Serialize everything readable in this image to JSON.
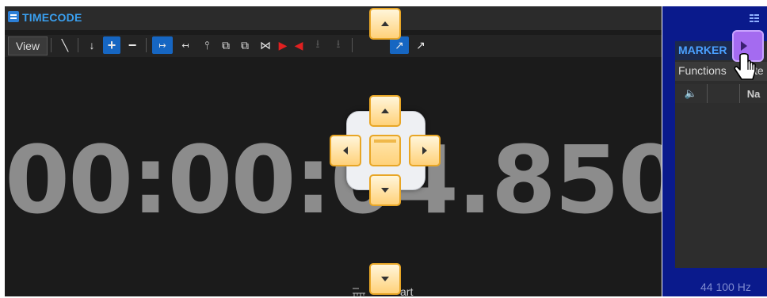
{
  "timecode_panel": {
    "title_bold": "TIME",
    "title_rest": "CODE",
    "view_menu": "View",
    "time_value": "00:00:04.850",
    "bottom_label": "art"
  },
  "marker_panel": {
    "tab_label": "MARKER",
    "functions_label": "Functions",
    "functions_trailing": "te",
    "column_speaker": "🔈",
    "column_name_partial": "Na",
    "frequency": "44 100 Hz"
  },
  "toolbar_icons": [
    "pencil-icon",
    "arrow-down-icon",
    "plus-icon",
    "minus-icon",
    "ruler-start-icon",
    "ruler-end-icon",
    "split-icon",
    "move-left-icon",
    "move-right-icon",
    "bowtie-icon",
    "red-play-icon",
    "red-back-icon",
    "export-icon",
    "import-icon",
    "marker-tool-icon",
    "marker-tool2-icon"
  ],
  "colors": {
    "accent_blue": "#3aa0f0",
    "marker_bg": "#0a1a8c",
    "dock_orange": "#ffd27a",
    "purple_button": "#a46bf0"
  }
}
